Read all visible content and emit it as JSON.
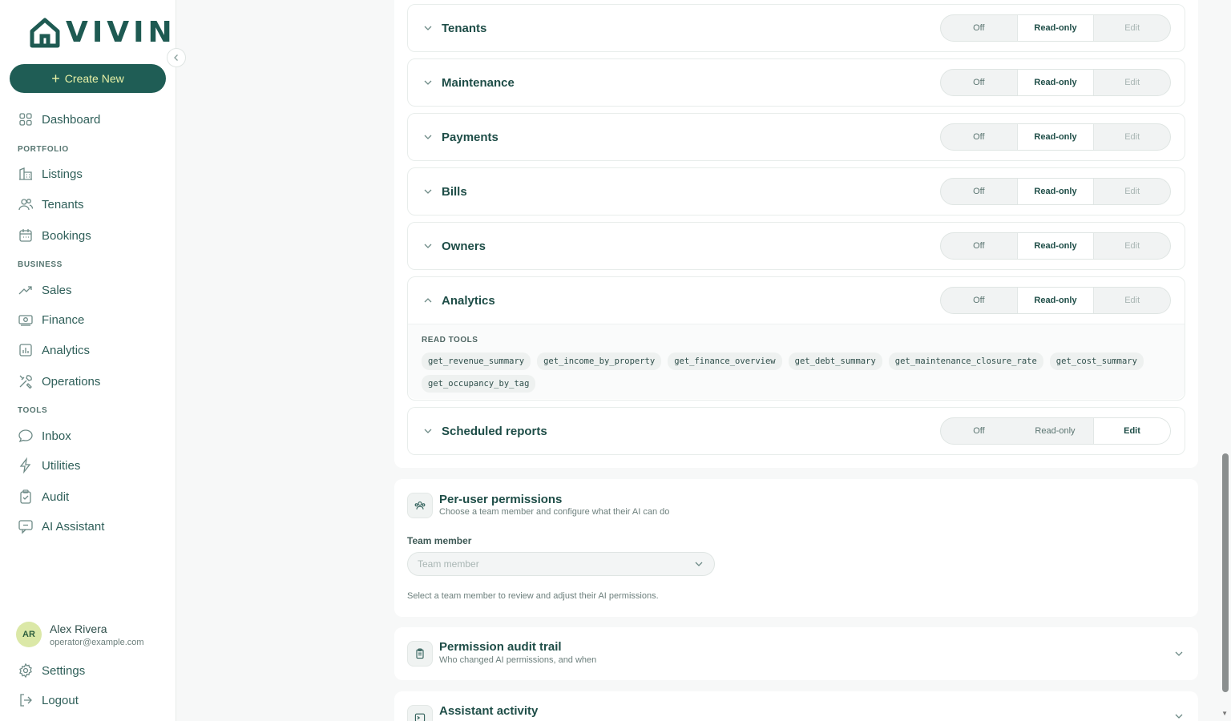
{
  "brand": {
    "logo_text": "VIVIN"
  },
  "sidebar": {
    "create_label": "Create New",
    "dashboard": "Dashboard",
    "sections": {
      "portfolio": "PORTFOLIO",
      "business": "BUSINESS",
      "tools": "TOOLS"
    },
    "items": {
      "listings": "Listings",
      "tenants": "Tenants",
      "bookings": "Bookings",
      "sales": "Sales",
      "finance": "Finance",
      "analytics": "Analytics",
      "operations": "Operations",
      "inbox": "Inbox",
      "utilities": "Utilities",
      "audit": "Audit",
      "ai_assistant": "AI Assistant"
    },
    "user": {
      "initials": "AR",
      "name": "Alex Rivera",
      "email": "operator@example.com"
    },
    "settings": "Settings",
    "logout": "Logout"
  },
  "segment_labels": {
    "off": "Off",
    "read": "Read-only",
    "edit": "Edit"
  },
  "modules": [
    {
      "name": "Tenants",
      "selected": "read"
    },
    {
      "name": "Maintenance",
      "selected": "read"
    },
    {
      "name": "Payments",
      "selected": "read"
    },
    {
      "name": "Bills",
      "selected": "read"
    },
    {
      "name": "Owners",
      "selected": "read"
    },
    {
      "name": "Analytics",
      "selected": "read",
      "expanded": true
    },
    {
      "name": "Scheduled reports",
      "selected": "edit"
    }
  ],
  "analytics_tools": {
    "heading": "READ TOOLS",
    "tools": [
      "get_revenue_summary",
      "get_income_by_property",
      "get_finance_overview",
      "get_debt_summary",
      "get_maintenance_closure_rate",
      "get_cost_summary",
      "get_occupancy_by_tag"
    ]
  },
  "per_user": {
    "title": "Per-user permissions",
    "subtitle": "Choose a team member and configure what their AI can do",
    "field_label": "Team member",
    "placeholder": "Team member",
    "hint": "Select a team member to review and adjust their AI permissions."
  },
  "audit_trail": {
    "title": "Permission audit trail",
    "subtitle": "Who changed AI permissions, and when"
  },
  "assistant_activity": {
    "title": "Assistant activity"
  },
  "colors": {
    "primary": "#1f5d55",
    "accent_text": "#e8f1a6",
    "avatar_bg": "#dbe8a7"
  }
}
